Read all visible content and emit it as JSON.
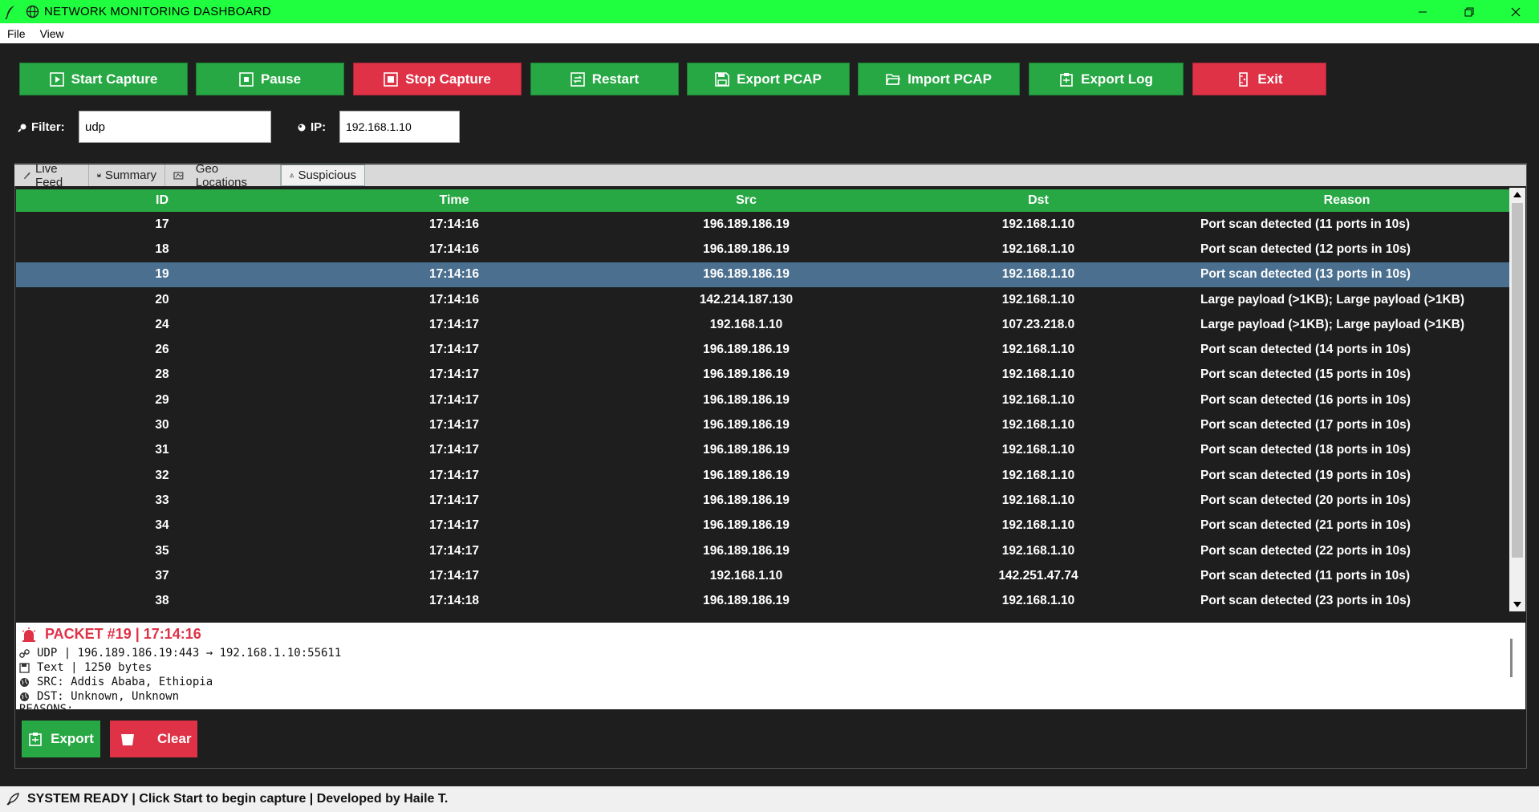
{
  "window": {
    "title": "NETWORK MONITORING DASHBOARD",
    "controls": [
      "minimize",
      "restore",
      "close"
    ]
  },
  "menu": {
    "items": [
      "File",
      "View"
    ]
  },
  "toolbar": {
    "start_capture": "Start Capture",
    "pause": "Pause",
    "stop_capture": "Stop Capture",
    "restart": "Restart",
    "export_pcap": "Export PCAP",
    "import_pcap": "Import PCAP",
    "export_log": "Export Log",
    "exit": "Exit"
  },
  "filters": {
    "filter_label": "Filter:",
    "filter_value": "udp",
    "ip_label": "IP:",
    "ip_value": "192.168.1.10"
  },
  "tabs": [
    {
      "label": "Live Feed",
      "icon": "pencil-icon"
    },
    {
      "label": "Summary",
      "icon": "save-icon"
    },
    {
      "label": "Geo Locations",
      "icon": "map-icon"
    },
    {
      "label": "Suspicious",
      "icon": "warning-icon",
      "active": true
    }
  ],
  "table": {
    "headers": {
      "id": "ID",
      "time": "Time",
      "src": "Src",
      "dst": "Dst",
      "reason": "Reason"
    },
    "rows": [
      {
        "id": "17",
        "time": "17:14:16",
        "src": "196.189.186.19",
        "dst": "192.168.1.10",
        "reason": "Port scan detected (11 ports in 10s)"
      },
      {
        "id": "18",
        "time": "17:14:16",
        "src": "196.189.186.19",
        "dst": "192.168.1.10",
        "reason": "Port scan detected (12 ports in 10s)"
      },
      {
        "id": "19",
        "time": "17:14:16",
        "src": "196.189.186.19",
        "dst": "192.168.1.10",
        "reason": "Port scan detected (13 ports in 10s)",
        "selected": true
      },
      {
        "id": "20",
        "time": "17:14:16",
        "src": "142.214.187.130",
        "dst": "192.168.1.10",
        "reason": "Large payload (>1KB); Large payload (>1KB)"
      },
      {
        "id": "24",
        "time": "17:14:17",
        "src": "192.168.1.10",
        "dst": "107.23.218.0",
        "reason": "Large payload (>1KB); Large payload (>1KB)"
      },
      {
        "id": "26",
        "time": "17:14:17",
        "src": "196.189.186.19",
        "dst": "192.168.1.10",
        "reason": "Port scan detected (14 ports in 10s)"
      },
      {
        "id": "28",
        "time": "17:14:17",
        "src": "196.189.186.19",
        "dst": "192.168.1.10",
        "reason": "Port scan detected (15 ports in 10s)"
      },
      {
        "id": "29",
        "time": "17:14:17",
        "src": "196.189.186.19",
        "dst": "192.168.1.10",
        "reason": "Port scan detected (16 ports in 10s)"
      },
      {
        "id": "30",
        "time": "17:14:17",
        "src": "196.189.186.19",
        "dst": "192.168.1.10",
        "reason": "Port scan detected (17 ports in 10s)"
      },
      {
        "id": "31",
        "time": "17:14:17",
        "src": "196.189.186.19",
        "dst": "192.168.1.10",
        "reason": "Port scan detected (18 ports in 10s)"
      },
      {
        "id": "32",
        "time": "17:14:17",
        "src": "196.189.186.19",
        "dst": "192.168.1.10",
        "reason": "Port scan detected (19 ports in 10s)"
      },
      {
        "id": "33",
        "time": "17:14:17",
        "src": "196.189.186.19",
        "dst": "192.168.1.10",
        "reason": "Port scan detected (20 ports in 10s)"
      },
      {
        "id": "34",
        "time": "17:14:17",
        "src": "196.189.186.19",
        "dst": "192.168.1.10",
        "reason": "Port scan detected (21 ports in 10s)"
      },
      {
        "id": "35",
        "time": "17:14:17",
        "src": "196.189.186.19",
        "dst": "192.168.1.10",
        "reason": "Port scan detected (22 ports in 10s)"
      },
      {
        "id": "37",
        "time": "17:14:17",
        "src": "192.168.1.10",
        "dst": "142.251.47.74",
        "reason": "Port scan detected (11 ports in 10s)"
      },
      {
        "id": "38",
        "time": "17:14:18",
        "src": "196.189.186.19",
        "dst": "192.168.1.10",
        "reason": "Port scan detected (23 ports in 10s)"
      }
    ]
  },
  "detail": {
    "header": "PACKET #19 | 17:14:16",
    "protocol_line": "UDP | 196.189.186.19:443 → 192.168.1.10:55611",
    "payload_line": "Text | 1250 bytes",
    "src_line": "SRC: Addis Ababa, Ethiopia",
    "dst_line": "DST: Unknown, Unknown",
    "reasons_line": "REASONS:"
  },
  "actions": {
    "export": "Export",
    "clear": "Clear"
  },
  "status": {
    "text": "SYSTEM READY | Click Start to begin capture | Developed by Haile T."
  },
  "colors": {
    "titlebar": "#1fff3f",
    "accent_green": "#27a844",
    "accent_red": "#df3247",
    "background": "#1e1e1e",
    "selected_row": "#4a6f8f"
  }
}
